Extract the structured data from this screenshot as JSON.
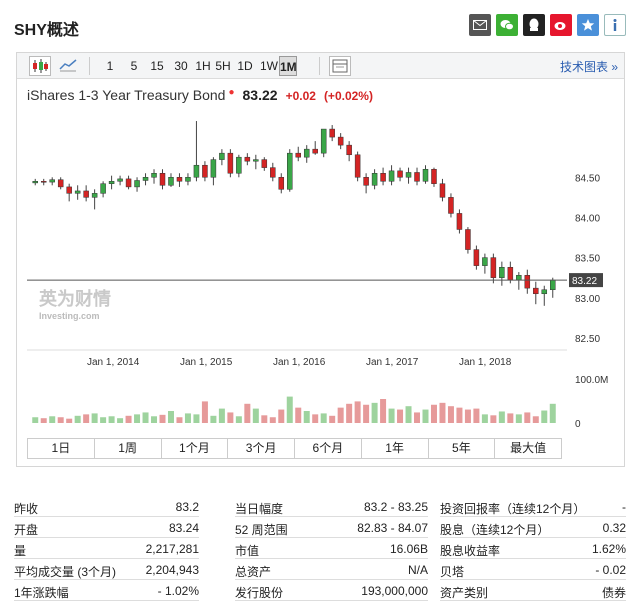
{
  "header": {
    "title": "SHY概述"
  },
  "toolbar": {
    "intervals": [
      "1",
      "5",
      "15",
      "30",
      "1H",
      "5H",
      "1D",
      "1W",
      "1M"
    ],
    "active_interval": "1M",
    "tech_chart": "技术图表 »"
  },
  "quote": {
    "name": "iShares 1-3 Year Treasury Bond",
    "price": "83.22",
    "change": "+0.02",
    "change_pct": "(+0.02%)",
    "up_color": "#d42424",
    "down_color": "#3aa648"
  },
  "watermark": {
    "brand": "英为财情",
    "sub": "Investing.com"
  },
  "chart_data": {
    "type": "candlestick",
    "y_ticks": [
      "84.50",
      "84.00",
      "83.50",
      "83.00",
      "82.50"
    ],
    "x_ticks": [
      "Jan 1, 2014",
      "Jan 1, 2015",
      "Jan 1, 2016",
      "Jan 1, 2017",
      "Jan 1, 2018"
    ],
    "current_label": "83.22",
    "volume_ticks": [
      "100.0M",
      "0"
    ],
    "ylim": [
      82.35,
      85.3
    ],
    "candles": [
      {
        "o": 84.43,
        "h": 84.48,
        "l": 84.4,
        "c": 84.45
      },
      {
        "o": 84.45,
        "h": 84.48,
        "l": 84.4,
        "c": 84.44
      },
      {
        "o": 84.44,
        "h": 84.5,
        "l": 84.4,
        "c": 84.47
      },
      {
        "o": 84.47,
        "h": 84.5,
        "l": 84.35,
        "c": 84.38
      },
      {
        "o": 84.38,
        "h": 84.42,
        "l": 84.2,
        "c": 84.3
      },
      {
        "o": 84.3,
        "h": 84.4,
        "l": 84.22,
        "c": 84.33
      },
      {
        "o": 84.33,
        "h": 84.4,
        "l": 84.2,
        "c": 84.25
      },
      {
        "o": 84.25,
        "h": 84.35,
        "l": 84.1,
        "c": 84.3
      },
      {
        "o": 84.3,
        "h": 84.45,
        "l": 84.25,
        "c": 84.42
      },
      {
        "o": 84.42,
        "h": 84.52,
        "l": 84.35,
        "c": 84.45
      },
      {
        "o": 84.45,
        "h": 84.52,
        "l": 84.4,
        "c": 84.48
      },
      {
        "o": 84.48,
        "h": 84.52,
        "l": 84.35,
        "c": 84.38
      },
      {
        "o": 84.38,
        "h": 84.5,
        "l": 84.32,
        "c": 84.46
      },
      {
        "o": 84.46,
        "h": 84.55,
        "l": 84.4,
        "c": 84.5
      },
      {
        "o": 84.5,
        "h": 84.6,
        "l": 84.42,
        "c": 84.55
      },
      {
        "o": 84.55,
        "h": 84.6,
        "l": 84.35,
        "c": 84.4
      },
      {
        "o": 84.4,
        "h": 84.55,
        "l": 84.38,
        "c": 84.5
      },
      {
        "o": 84.5,
        "h": 84.55,
        "l": 84.38,
        "c": 84.45
      },
      {
        "o": 84.45,
        "h": 84.55,
        "l": 84.4,
        "c": 84.5
      },
      {
        "o": 84.5,
        "h": 85.2,
        "l": 84.45,
        "c": 84.65
      },
      {
        "o": 84.65,
        "h": 84.7,
        "l": 84.45,
        "c": 84.5
      },
      {
        "o": 84.5,
        "h": 84.75,
        "l": 84.4,
        "c": 84.72
      },
      {
        "o": 84.72,
        "h": 84.85,
        "l": 84.65,
        "c": 84.8
      },
      {
        "o": 84.8,
        "h": 84.85,
        "l": 84.5,
        "c": 84.55
      },
      {
        "o": 84.55,
        "h": 84.78,
        "l": 84.5,
        "c": 84.75
      },
      {
        "o": 84.75,
        "h": 84.8,
        "l": 84.65,
        "c": 84.7
      },
      {
        "o": 84.7,
        "h": 84.78,
        "l": 84.6,
        "c": 84.72
      },
      {
        "o": 84.72,
        "h": 84.75,
        "l": 84.58,
        "c": 84.62
      },
      {
        "o": 84.62,
        "h": 84.68,
        "l": 84.45,
        "c": 84.5
      },
      {
        "o": 84.5,
        "h": 84.55,
        "l": 84.3,
        "c": 84.35
      },
      {
        "o": 84.35,
        "h": 84.85,
        "l": 84.32,
        "c": 84.8
      },
      {
        "o": 84.8,
        "h": 84.88,
        "l": 84.7,
        "c": 84.75
      },
      {
        "o": 84.75,
        "h": 84.9,
        "l": 84.68,
        "c": 84.85
      },
      {
        "o": 84.85,
        "h": 84.95,
        "l": 84.78,
        "c": 84.8
      },
      {
        "o": 84.8,
        "h": 85.05,
        "l": 84.75,
        "c": 85.1
      },
      {
        "o": 85.1,
        "h": 85.15,
        "l": 84.95,
        "c": 85.0
      },
      {
        "o": 85.0,
        "h": 85.05,
        "l": 84.85,
        "c": 84.9
      },
      {
        "o": 84.9,
        "h": 84.95,
        "l": 84.7,
        "c": 84.78
      },
      {
        "o": 84.78,
        "h": 84.82,
        "l": 84.45,
        "c": 84.5
      },
      {
        "o": 84.5,
        "h": 84.55,
        "l": 84.3,
        "c": 84.4
      },
      {
        "o": 84.4,
        "h": 84.6,
        "l": 84.35,
        "c": 84.55
      },
      {
        "o": 84.55,
        "h": 84.62,
        "l": 84.4,
        "c": 84.45
      },
      {
        "o": 84.45,
        "h": 84.65,
        "l": 84.4,
        "c": 84.58
      },
      {
        "o": 84.58,
        "h": 84.62,
        "l": 84.45,
        "c": 84.5
      },
      {
        "o": 84.5,
        "h": 84.62,
        "l": 84.42,
        "c": 84.56
      },
      {
        "o": 84.56,
        "h": 84.62,
        "l": 84.4,
        "c": 84.45
      },
      {
        "o": 84.45,
        "h": 84.65,
        "l": 84.42,
        "c": 84.6
      },
      {
        "o": 84.6,
        "h": 84.62,
        "l": 84.38,
        "c": 84.42
      },
      {
        "o": 84.42,
        "h": 84.48,
        "l": 84.2,
        "c": 84.25
      },
      {
        "o": 84.25,
        "h": 84.3,
        "l": 84.0,
        "c": 84.05
      },
      {
        "o": 84.05,
        "h": 84.1,
        "l": 83.8,
        "c": 83.85
      },
      {
        "o": 83.85,
        "h": 83.88,
        "l": 83.55,
        "c": 83.6
      },
      {
        "o": 83.6,
        "h": 83.65,
        "l": 83.35,
        "c": 83.4
      },
      {
        "o": 83.4,
        "h": 83.55,
        "l": 83.3,
        "c": 83.5
      },
      {
        "o": 83.5,
        "h": 83.55,
        "l": 83.18,
        "c": 83.25
      },
      {
        "o": 83.25,
        "h": 83.45,
        "l": 83.15,
        "c": 83.38
      },
      {
        "o": 83.38,
        "h": 83.45,
        "l": 83.18,
        "c": 83.22
      },
      {
        "o": 83.22,
        "h": 83.32,
        "l": 83.1,
        "c": 83.28
      },
      {
        "o": 83.28,
        "h": 83.35,
        "l": 83.05,
        "c": 83.12
      },
      {
        "o": 83.12,
        "h": 83.2,
        "l": 82.92,
        "c": 83.05
      },
      {
        "o": 83.05,
        "h": 83.15,
        "l": 82.9,
        "c": 83.1
      },
      {
        "o": 83.1,
        "h": 83.25,
        "l": 83.0,
        "c": 83.22
      }
    ],
    "volume_max": 100,
    "volumes": [
      12,
      10,
      14,
      12,
      9,
      15,
      18,
      20,
      12,
      14,
      10,
      15,
      18,
      22,
      14,
      17,
      25,
      12,
      20,
      18,
      45,
      15,
      30,
      22,
      14,
      40,
      30,
      16,
      12,
      28,
      55,
      32,
      25,
      18,
      20,
      15,
      32,
      40,
      45,
      38,
      42,
      50,
      30,
      28,
      35,
      22,
      28,
      38,
      42,
      35,
      32,
      28,
      30,
      18,
      16,
      24,
      20,
      18,
      22,
      14,
      26,
      40
    ]
  },
  "ranges": [
    "1日",
    "1周",
    "1个月",
    "3个月",
    "6个月",
    "1年",
    "5年",
    "最大值"
  ],
  "stats": {
    "col1": [
      {
        "label": "昨收",
        "value": "83.2"
      },
      {
        "label": "开盘",
        "value": "83.24"
      },
      {
        "label": "量",
        "value": "2,217,281"
      },
      {
        "label": "平均成交量 (3个月)",
        "value": "2,204,943"
      },
      {
        "label": "1年涨跌幅",
        "value": "- 1.02%"
      }
    ],
    "col2": [
      {
        "label": "当日幅度",
        "value": "83.2 - 83.25"
      },
      {
        "label": "52 周范围",
        "value": "82.83 - 84.07"
      },
      {
        "label": "市值",
        "value": "16.06B"
      },
      {
        "label": "总资产",
        "value": "N/A"
      },
      {
        "label": "发行股份",
        "value": "193,000,000"
      }
    ],
    "col3": [
      {
        "label": "投资回报率（连续12个月）",
        "value": "-"
      },
      {
        "label": "股息（连续12个月）",
        "value": "0.32"
      },
      {
        "label": "股息收益率",
        "value": "1.62%"
      },
      {
        "label": "贝塔",
        "value": "- 0.02"
      },
      {
        "label": "资产类别",
        "value": "债券"
      }
    ]
  }
}
